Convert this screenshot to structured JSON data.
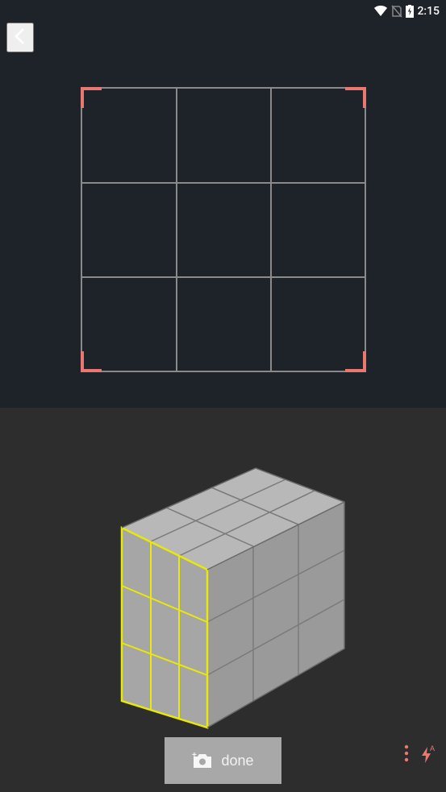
{
  "status": {
    "time": "2:15"
  },
  "capture": {
    "corner_color": "#e87870",
    "grid_color": "#8a8a8a"
  },
  "preview": {
    "highlight_color": "#e8e80a",
    "cube_fill": "#a8a8a8"
  },
  "controls": {
    "done_label": "done",
    "flash_mode": "A"
  }
}
